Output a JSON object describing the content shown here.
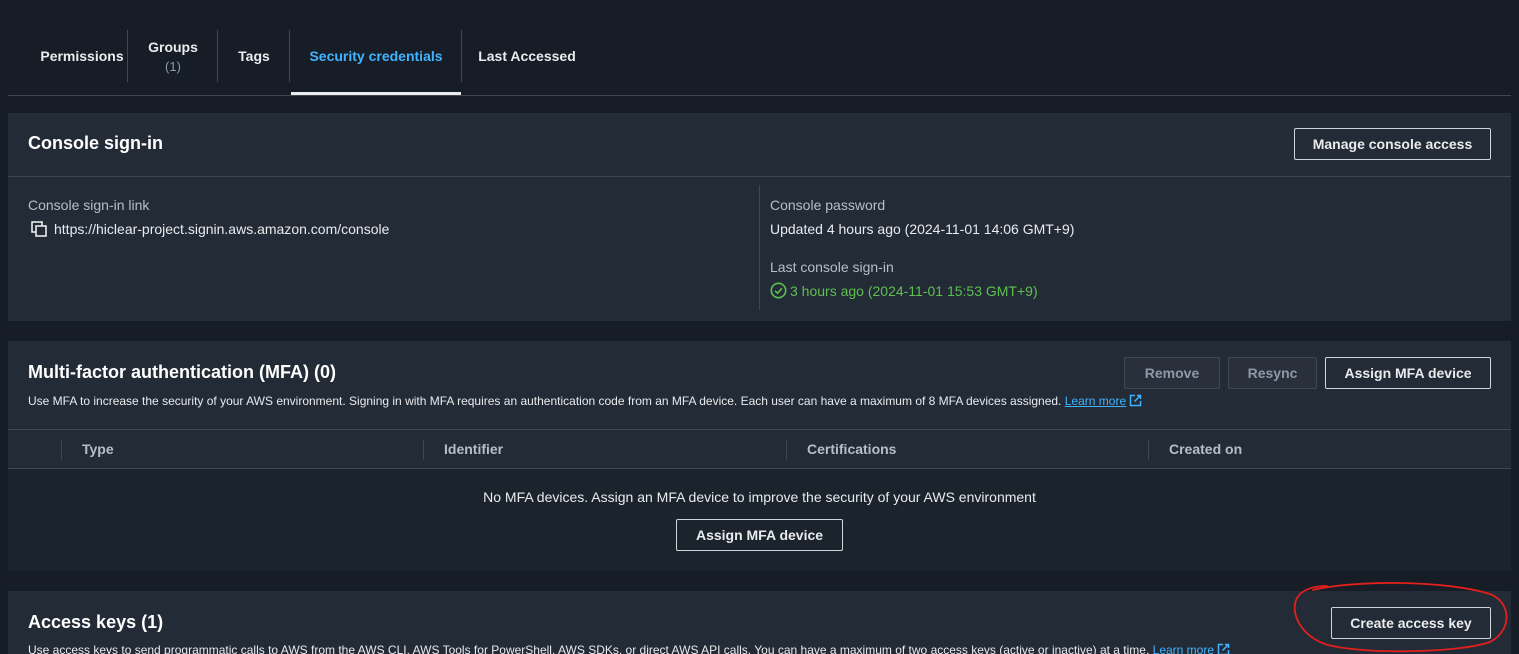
{
  "tabs": [
    {
      "label": "Permissions"
    },
    {
      "label": "Groups",
      "sub": "(1)"
    },
    {
      "label": "Tags"
    },
    {
      "label": "Security credentials"
    },
    {
      "label": "Last Accessed"
    }
  ],
  "console": {
    "title": "Console sign-in",
    "manage_button": "Manage console access",
    "link_label": "Console sign-in link",
    "link_value": "https://hiclear-project.signin.aws.amazon.com/console",
    "password_label": "Console password",
    "password_value": "Updated 4 hours ago (2024-11-01 14:06 GMT+9)",
    "last_signin_label": "Last console sign-in",
    "last_signin_value": "3 hours ago (2024-11-01 15:53 GMT+9)"
  },
  "mfa": {
    "title": "Multi-factor authentication (MFA) (0)",
    "remove_button": "Remove",
    "resync_button": "Resync",
    "assign_button": "Assign MFA device",
    "description": "Use MFA to increase the security of your AWS environment. Signing in with MFA requires an authentication code from an MFA device. Each user can have a maximum of 8 MFA devices assigned.",
    "learn_more": "Learn more",
    "columns": [
      "Type",
      "Identifier",
      "Certifications",
      "Created on"
    ],
    "empty_message": "No MFA devices. Assign an MFA device to improve the security of your AWS environment",
    "empty_assign_button": "Assign MFA device"
  },
  "access_keys": {
    "title": "Access keys (1)",
    "create_button": "Create access key",
    "description": "Use access keys to send programmatic calls to AWS from the AWS CLI, AWS Tools for PowerShell, AWS SDKs, or direct AWS API calls. You can have a maximum of two access keys (active or inactive) at a time.",
    "learn_more": "Learn more"
  },
  "colors": {
    "accent": "#42b4ff",
    "success": "#5fbf50",
    "annotation": "#e0201c"
  }
}
